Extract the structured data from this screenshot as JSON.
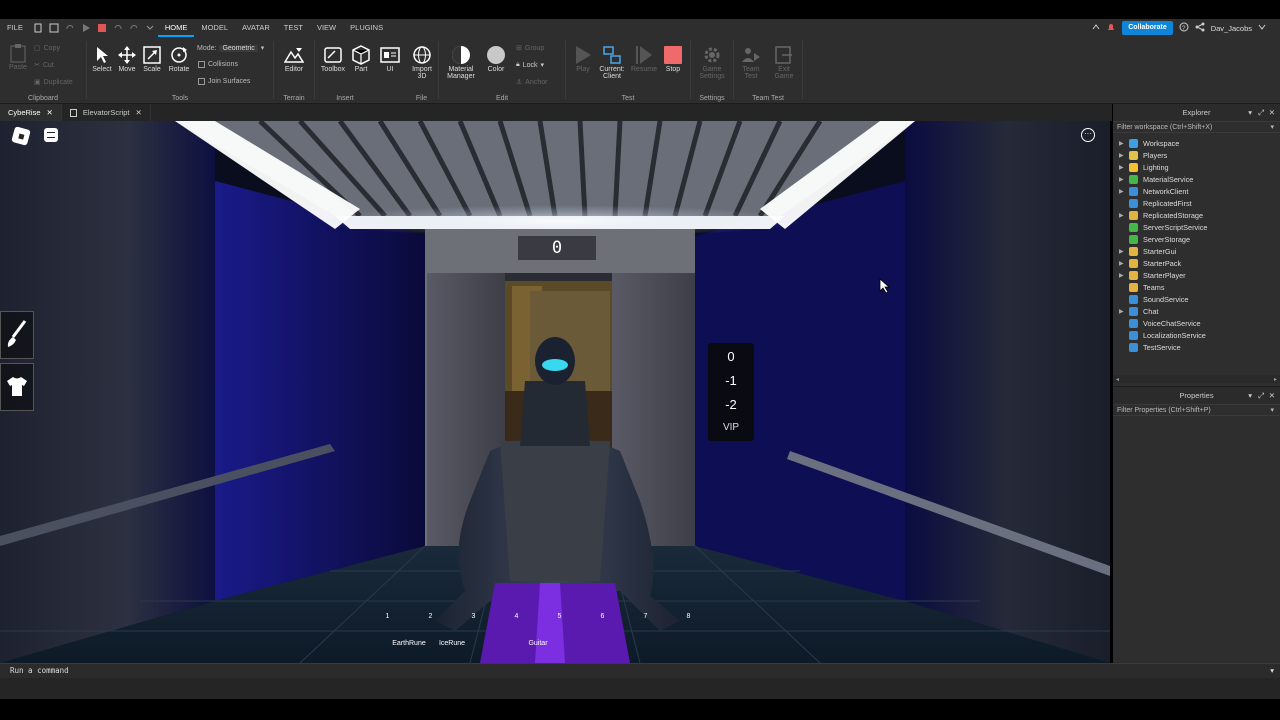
{
  "menu": {
    "items": [
      "FILE",
      "HOME",
      "MODEL",
      "AVATAR",
      "TEST",
      "VIEW",
      "PLUGINS"
    ],
    "active": "HOME"
  },
  "account": {
    "collaborate_label": "Collaborate",
    "username": "Dav_Jacobs"
  },
  "ribbon": {
    "clipboard": {
      "label": "Clipboard",
      "paste": "Paste",
      "copy": "Copy",
      "cut": "Cut",
      "duplicate": "Duplicate"
    },
    "tools": {
      "label": "Tools",
      "select": "Select",
      "move": "Move",
      "scale": "Scale",
      "rotate": "Rotate",
      "mode_label": "Mode:",
      "mode_value": "Geometric",
      "collisions": "Collisions",
      "join_surfaces": "Join Surfaces"
    },
    "terrain": {
      "label": "Terrain",
      "editor": "Editor"
    },
    "insert": {
      "label": "Insert",
      "toolbox": "Toolbox",
      "part": "Part",
      "ui": "UI"
    },
    "file": {
      "label": "File",
      "import_line1": "Import",
      "import_line2": "3D"
    },
    "edit": {
      "label": "Edit",
      "material_line1": "Material",
      "material_line2": "Manager",
      "color": "Color",
      "group": "Group",
      "lock": "Lock",
      "anchor": "Anchor"
    },
    "test": {
      "label": "Test",
      "play": "Play",
      "current_line1": "Current:",
      "current_line2": "Client",
      "resume": "Resume",
      "stop": "Stop"
    },
    "settings": {
      "label": "Settings",
      "game_line1": "Game",
      "game_line2": "Settings"
    },
    "team_test": {
      "label": "Team Test",
      "team_line1": "Team",
      "team_line2": "Test",
      "exit_line1": "Exit",
      "exit_line2": "Game"
    }
  },
  "tabs": [
    {
      "label": "CybeRise",
      "active": true
    },
    {
      "label": "ElevatorScript",
      "active": false
    }
  ],
  "viewport": {
    "floor_display": "0",
    "elevator_buttons": [
      "0",
      "-1",
      "-2",
      "VIP"
    ],
    "hotbar": [
      {
        "num": "1",
        "label": "EarthRune"
      },
      {
        "num": "2",
        "label": "IceRune"
      },
      {
        "num": "3",
        "label": ""
      },
      {
        "num": "4",
        "label": "Guitar"
      },
      {
        "num": "5",
        "label": ""
      },
      {
        "num": "6",
        "label": ""
      },
      {
        "num": "7",
        "label": ""
      },
      {
        "num": "8",
        "label": ""
      }
    ]
  },
  "explorer": {
    "title": "Explorer",
    "filter_placeholder": "Filter workspace (Ctrl+Shift+X)",
    "items": [
      {
        "label": "Workspace",
        "expand": true,
        "color": "#3aa0e8"
      },
      {
        "label": "Players",
        "expand": true,
        "color": "#e0c34a"
      },
      {
        "label": "Lighting",
        "expand": true,
        "color": "#f2c230"
      },
      {
        "label": "MaterialService",
        "expand": true,
        "color": "#45b649"
      },
      {
        "label": "NetworkClient",
        "expand": true,
        "color": "#3a8fd8"
      },
      {
        "label": "ReplicatedFirst",
        "expand": false,
        "color": "#3a8fd8"
      },
      {
        "label": "ReplicatedStorage",
        "expand": true,
        "color": "#e3b341"
      },
      {
        "label": "ServerScriptService",
        "expand": false,
        "color": "#45b649"
      },
      {
        "label": "ServerStorage",
        "expand": false,
        "color": "#45b649"
      },
      {
        "label": "StarterGui",
        "expand": true,
        "color": "#e3b341"
      },
      {
        "label": "StarterPack",
        "expand": true,
        "color": "#e3b341"
      },
      {
        "label": "StarterPlayer",
        "expand": true,
        "color": "#e3b341"
      },
      {
        "label": "Teams",
        "expand": false,
        "color": "#e3b341"
      },
      {
        "label": "SoundService",
        "expand": false,
        "color": "#3a8fd8"
      },
      {
        "label": "Chat",
        "expand": true,
        "color": "#3a8fd8"
      },
      {
        "label": "VoiceChatService",
        "expand": false,
        "color": "#3a8fd8"
      },
      {
        "label": "LocalizationService",
        "expand": false,
        "color": "#3a8fd8"
      },
      {
        "label": "TestService",
        "expand": false,
        "color": "#3a8fd8"
      }
    ]
  },
  "properties": {
    "title": "Properties",
    "filter_placeholder": "Filter Properties (Ctrl+Shift+P)"
  },
  "command_bar": {
    "placeholder": "Run a command"
  }
}
